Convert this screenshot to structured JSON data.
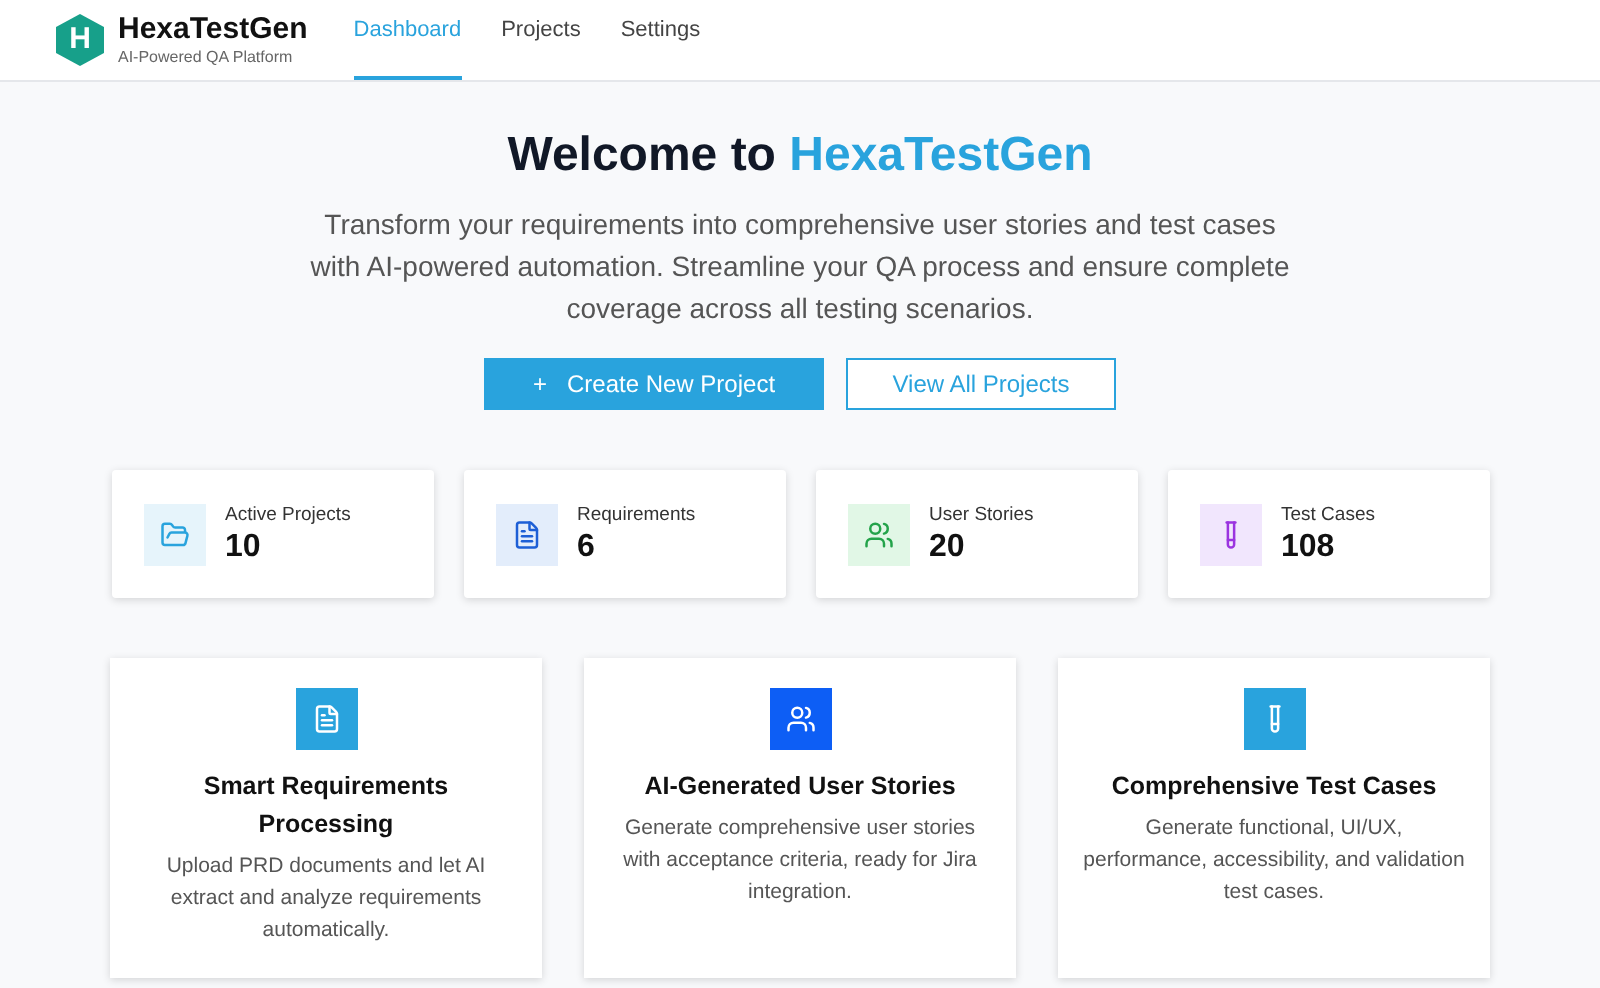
{
  "brand": {
    "name": "HexaTestGen",
    "tagline": "AI-Powered QA Platform",
    "logo_letter": "H"
  },
  "nav": [
    {
      "label": "Dashboard",
      "selected": true
    },
    {
      "label": "Projects",
      "selected": false
    },
    {
      "label": "Settings",
      "selected": false
    }
  ],
  "hero": {
    "title": "Welcome to ",
    "title_highlight": "HexaTestGen",
    "text": "Transform your requirements into comprehensive user stories and test cases with AI-powered automation. Streamline your QA process and ensure complete coverage across all testing scenarios.",
    "primary_button": {
      "icon": "+",
      "label": "Create New Project"
    },
    "secondary_button": "View All Projects"
  },
  "stats": [
    {
      "kind": "folder",
      "label": "Active Projects",
      "value": "10"
    },
    {
      "kind": "document",
      "label": "Requirements",
      "value": "6"
    },
    {
      "kind": "users",
      "label": "User Stories",
      "value": "20"
    },
    {
      "kind": "tube",
      "label": "Test Cases",
      "value": "108"
    }
  ],
  "features": [
    {
      "kind": "document",
      "title": "Smart Requirements Processing",
      "text": "Upload PRD documents and let AI extract and analyze requirements automatically."
    },
    {
      "kind": "users",
      "title": "AI-Generated User Stories",
      "text": "Generate comprehensive user stories with acceptance criteria, ready for Jira integration."
    },
    {
      "kind": "tube",
      "title": "Comprehensive Test Cases",
      "text": "Generate functional, UI/UX, performance, accessibility, and validation test cases."
    }
  ]
}
